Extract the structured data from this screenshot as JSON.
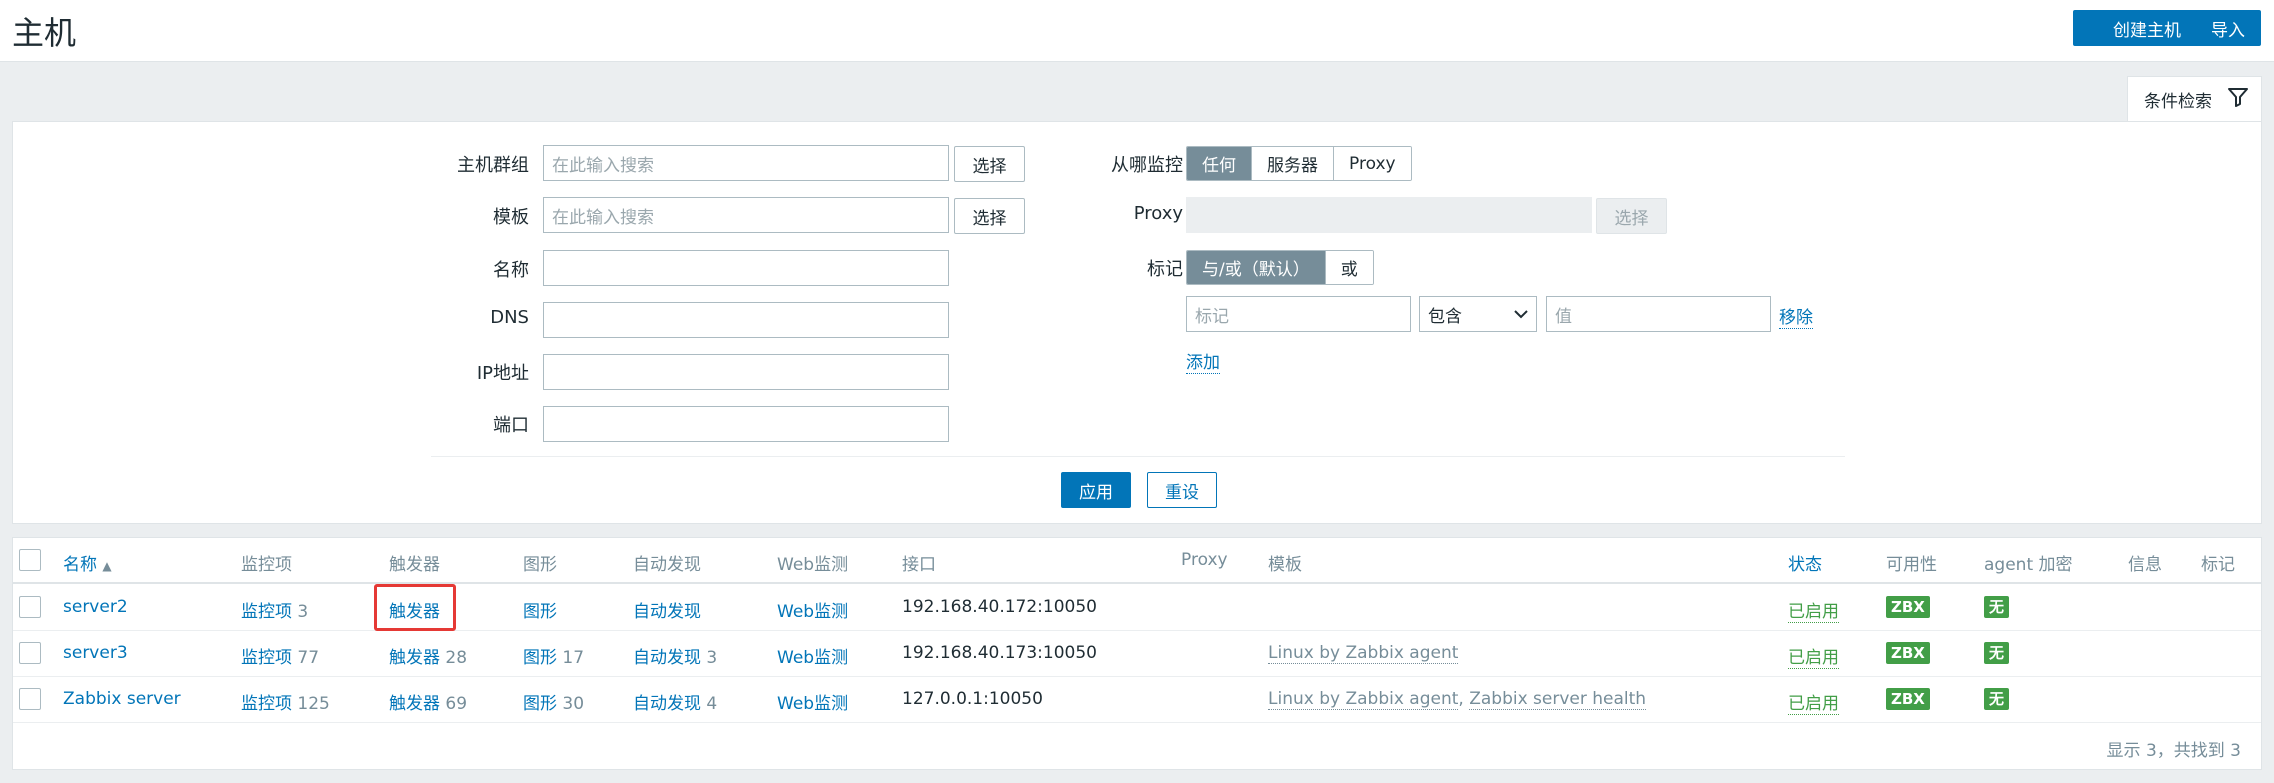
{
  "header": {
    "title": "主机",
    "create_button": "创建主机",
    "import_button": "导入"
  },
  "filter": {
    "tab_label": "条件检索",
    "host_groups_label": "主机群组",
    "host_groups_placeholder": "在此输入搜索",
    "templates_label": "模板",
    "templates_placeholder": "在此输入搜索",
    "select_label": "选择",
    "name_label": "名称",
    "dns_label": "DNS",
    "ip_label": "IP地址",
    "port_label": "端口",
    "monitored_by_label": "从哪监控",
    "monitored_by_options": [
      "任何",
      "服务器",
      "Proxy"
    ],
    "proxy_label": "Proxy",
    "tags_label": "标记",
    "tags_mode_options": [
      "与/或（默认）",
      "或"
    ],
    "tag_placeholder": "标记",
    "tag_operator": "包含",
    "tag_value_placeholder": "值",
    "remove_label": "移除",
    "add_label": "添加",
    "apply_button": "应用",
    "reset_button": "重设"
  },
  "table": {
    "columns": [
      "名称",
      "监控项",
      "触发器",
      "图形",
      "自动发现",
      "Web监测",
      "接口",
      "Proxy",
      "模板",
      "状态",
      "可用性",
      "agent 加密",
      "信息",
      "标记"
    ],
    "sort_indicator": "▲",
    "rows": [
      {
        "name": "server2",
        "items": "监控项",
        "items_count": "3",
        "triggers": "触发器",
        "triggers_count": "",
        "graphs": "图形",
        "graphs_count": "",
        "discovery": "自动发现",
        "discovery_count": "",
        "web": "Web监测",
        "interface": "192.168.40.172:10050",
        "templates": [],
        "status": "已启用",
        "availability": "ZBX",
        "encryption": "无"
      },
      {
        "name": "server3",
        "items": "监控项",
        "items_count": "77",
        "triggers": "触发器",
        "triggers_count": "28",
        "graphs": "图形",
        "graphs_count": "17",
        "discovery": "自动发现",
        "discovery_count": "3",
        "web": "Web监测",
        "interface": "192.168.40.173:10050",
        "templates": [
          "Linux by Zabbix agent"
        ],
        "status": "已启用",
        "availability": "ZBX",
        "encryption": "无"
      },
      {
        "name": "Zabbix server",
        "items": "监控项",
        "items_count": "125",
        "triggers": "触发器",
        "triggers_count": "69",
        "graphs": "图形",
        "graphs_count": "30",
        "discovery": "自动发现",
        "discovery_count": "4",
        "web": "Web监测",
        "interface": "127.0.0.1:10050",
        "templates": [
          "Linux by Zabbix agent",
          "Zabbix server health"
        ],
        "status": "已启用",
        "availability": "ZBX",
        "encryption": "无"
      }
    ],
    "template_separator": ", ",
    "footer": "显示 3，共找到 3"
  },
  "colors": {
    "accent": "#0275b8",
    "status_green": "#429e47",
    "highlight": "#e53935"
  }
}
